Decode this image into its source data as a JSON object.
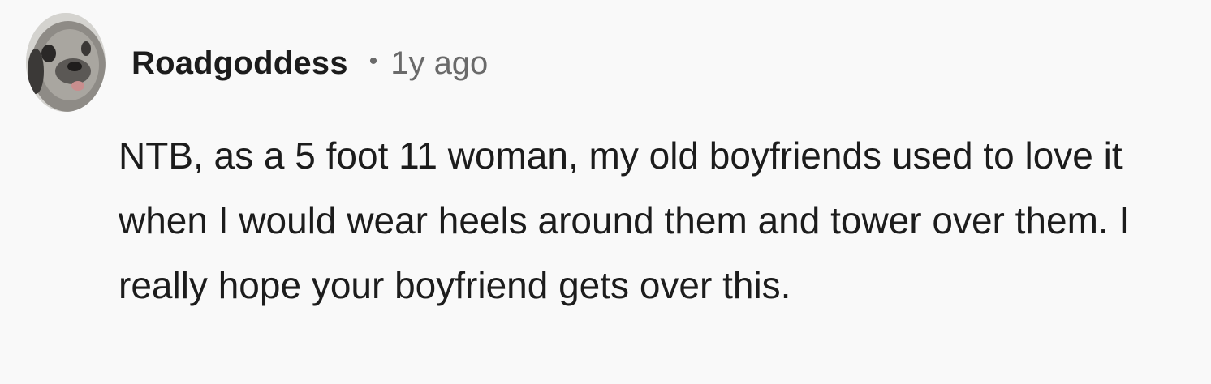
{
  "comment": {
    "username": "Roadgoddess",
    "separator": "•",
    "timestamp": "1y ago",
    "text": "NTB, as a 5 foot 11 woman, my old boyfriends used to love it when I would wear heels around them and tower over them. I really hope your boyfriend gets over this."
  },
  "colors": {
    "background": "#f9f9f9",
    "text": "#1c1c1c",
    "meta": "#6a6a6a"
  },
  "avatar": {
    "icon": "dog-avatar-icon"
  }
}
